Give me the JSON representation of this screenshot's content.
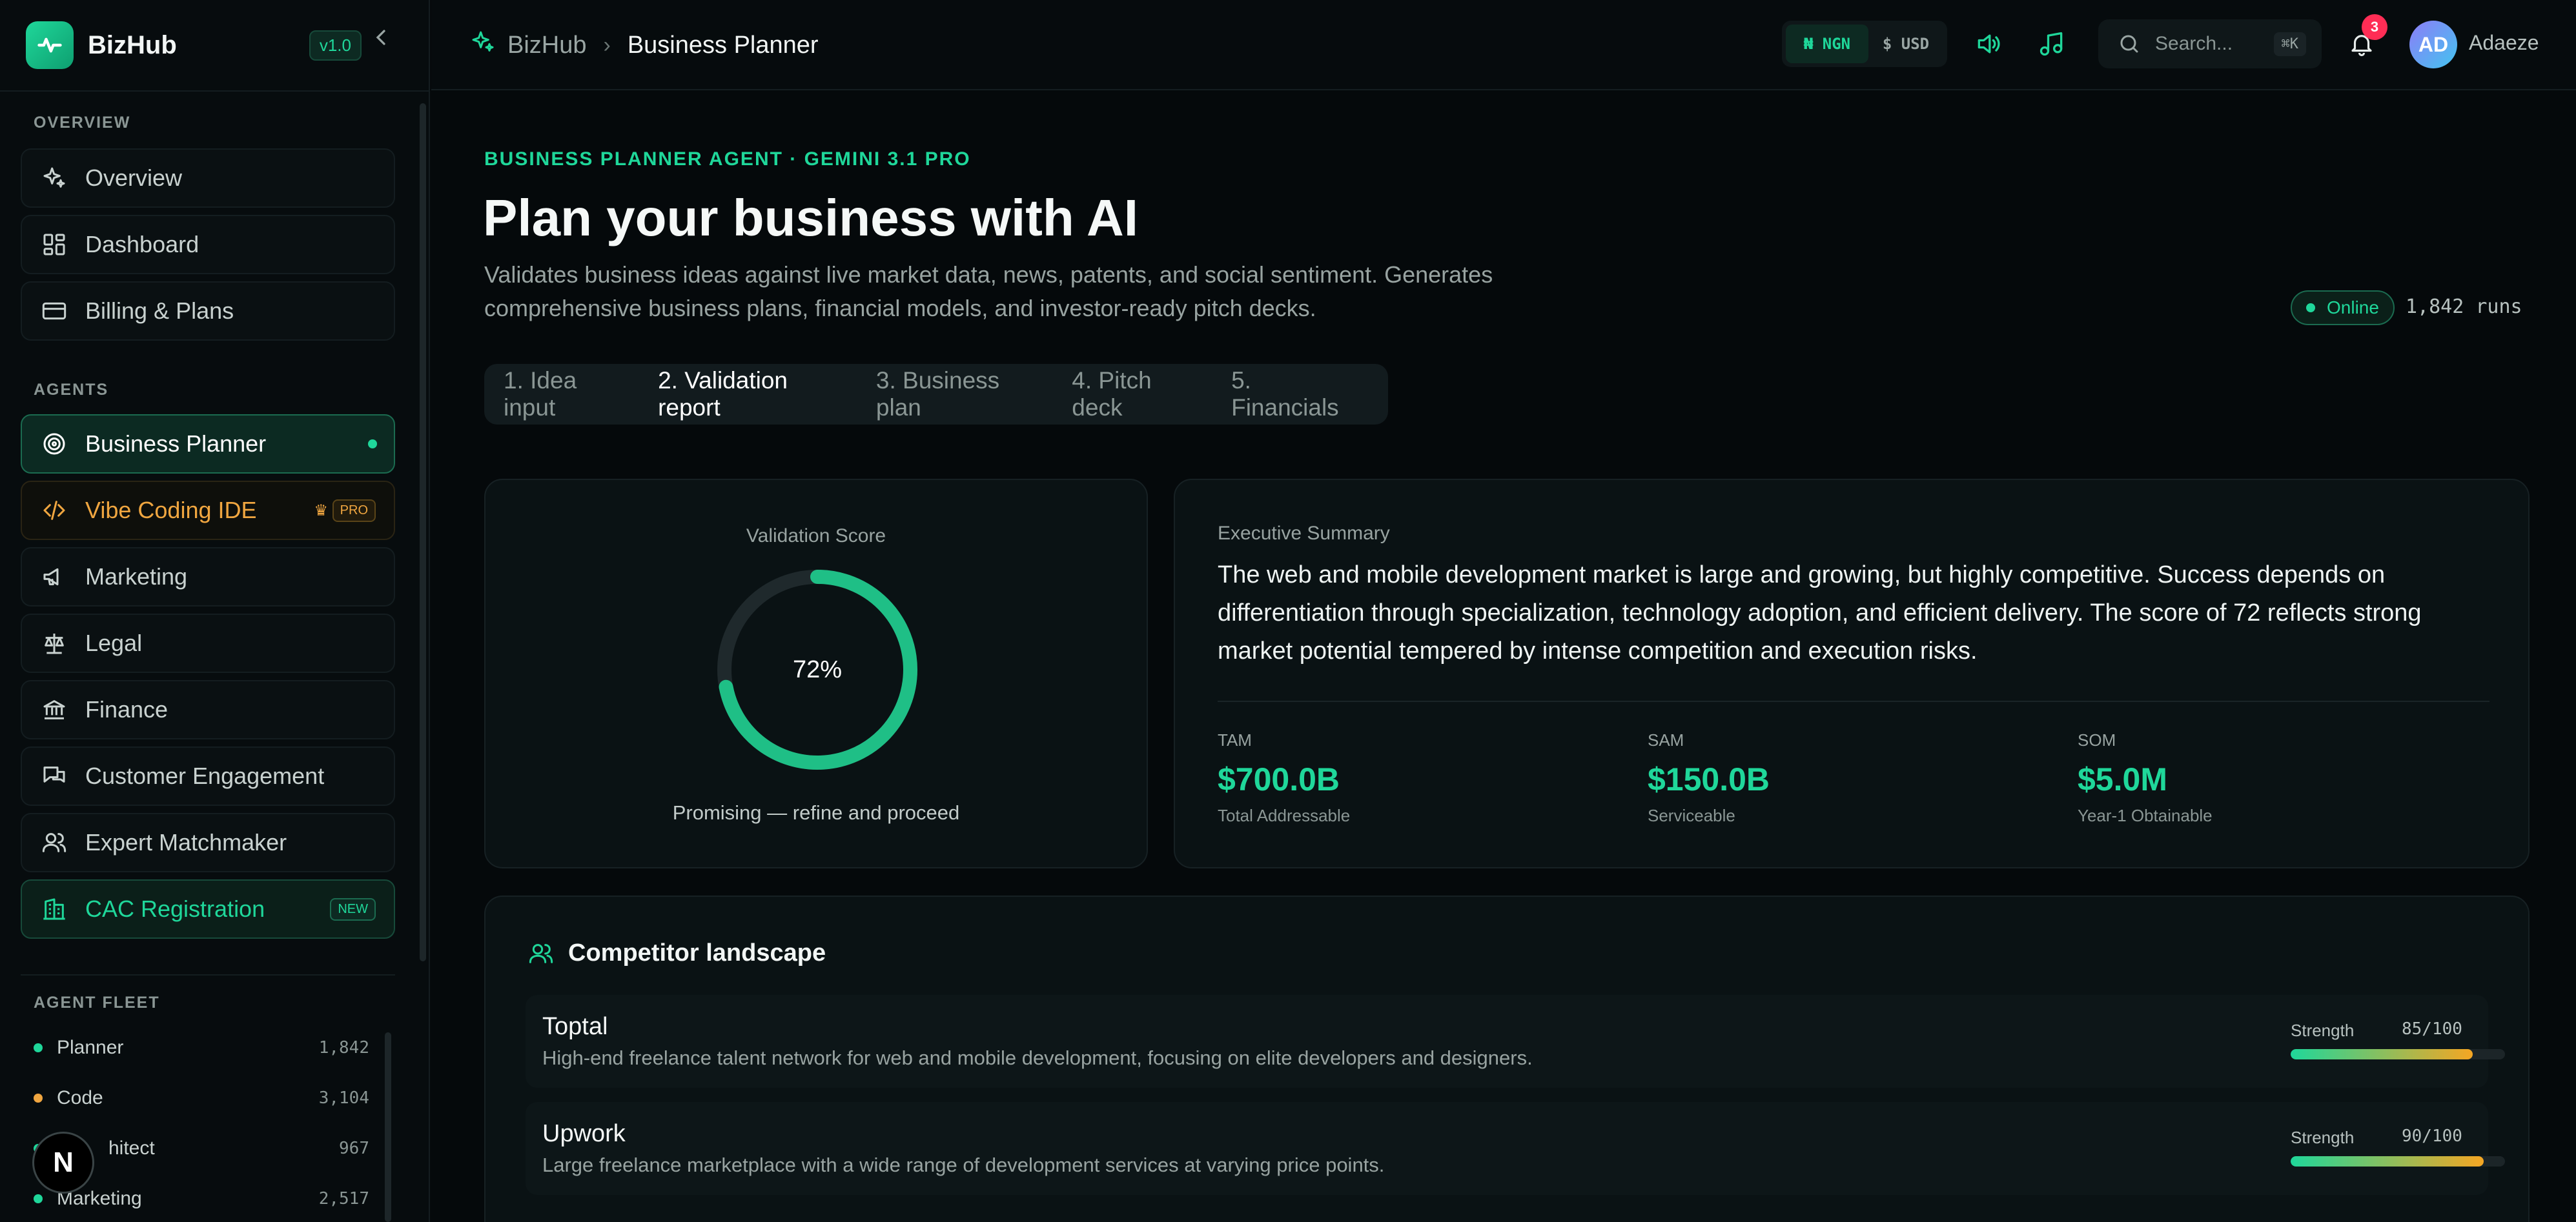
{
  "brand": {
    "name": "BizHub",
    "version": "v1.0"
  },
  "sidebar": {
    "overview_label": "OVERVIEW",
    "overview_items": [
      {
        "label": "Overview",
        "icon": "sparkles-icon"
      },
      {
        "label": "Dashboard",
        "icon": "grid-icon"
      },
      {
        "label": "Billing & Plans",
        "icon": "credit-card-icon"
      }
    ],
    "agents_label": "AGENTS",
    "agent_items": [
      {
        "label": "Business Planner",
        "icon": "target-icon",
        "active": true
      },
      {
        "label": "Vibe Coding IDE",
        "icon": "code-icon",
        "badge": "PRO"
      },
      {
        "label": "Marketing",
        "icon": "megaphone-icon"
      },
      {
        "label": "Legal",
        "icon": "scale-icon"
      },
      {
        "label": "Finance",
        "icon": "bank-icon"
      },
      {
        "label": "Customer Engagement",
        "icon": "chat-icon"
      },
      {
        "label": "Expert Matchmaker",
        "icon": "users-icon"
      },
      {
        "label": "CAC Registration",
        "icon": "building-icon",
        "badge": "NEW"
      }
    ],
    "fleet_label": "AGENT FLEET",
    "fleet": [
      {
        "name": "Planner",
        "count": "1,842",
        "color": "#1fd79a"
      },
      {
        "name": "Code",
        "count": "3,104",
        "color": "#f0a640"
      },
      {
        "name": "hitect",
        "count": "967",
        "color": "#1fd79a"
      },
      {
        "name": "Marketing",
        "count": "2,517",
        "color": "#1fd79a"
      }
    ],
    "n_avatar": "N"
  },
  "topbar": {
    "crumb_root": "BizHub",
    "crumb_current": "Business Planner",
    "currency_active": "₦ NGN",
    "currency_other": "$ USD",
    "search_placeholder": "Search...",
    "search_shortcut": "⌘K",
    "notifications": "3",
    "user_initials": "AD",
    "user_name": "Adaeze"
  },
  "main": {
    "eyebrow": "BUSINESS PLANNER AGENT · GEMINI 3.1 PRO",
    "title": "Plan your business with AI",
    "description": "Validates business ideas against live market data, news, patents, and social sentiment. Generates comprehensive business plans, financial models, and investor-ready pitch decks.",
    "status": "Online",
    "runs": "1,842 runs",
    "steps": [
      "1. Idea input",
      "2. Validation report",
      "3. Business plan",
      "4. Pitch deck",
      "5. Financials"
    ],
    "active_step": 1
  },
  "score": {
    "label": "Validation Score",
    "value": 72,
    "display": "72%",
    "verdict": "Promising — refine and proceed"
  },
  "summary": {
    "label": "Executive Summary",
    "text": "The web and mobile development market is large and growing, but highly competitive. Success depends on differentiation through specialization, technology adoption, and efficient delivery. The score of 72 reflects strong market potential tempered by intense competition and execution risks.",
    "metrics": [
      {
        "label": "TAM",
        "value": "$700.0B",
        "sub": "Total Addressable"
      },
      {
        "label": "SAM",
        "value": "$150.0B",
        "sub": "Serviceable"
      },
      {
        "label": "SOM",
        "value": "$5.0M",
        "sub": "Year-1 Obtainable"
      }
    ]
  },
  "competitors": {
    "title": "Competitor landscape",
    "strength_label": "Strength",
    "items": [
      {
        "name": "Toptal",
        "desc": "High-end freelance talent network for web and mobile development, focusing on elite developers and designers.",
        "strength": 85,
        "strength_text": "85/100"
      },
      {
        "name": "Upwork",
        "desc": "Large freelance marketplace with a wide range of development services at varying price points.",
        "strength": 90,
        "strength_text": "90/100"
      }
    ]
  },
  "colors": {
    "accent": "#1fd79a",
    "pro": "#f0a640",
    "badge": "#ff2d55"
  }
}
